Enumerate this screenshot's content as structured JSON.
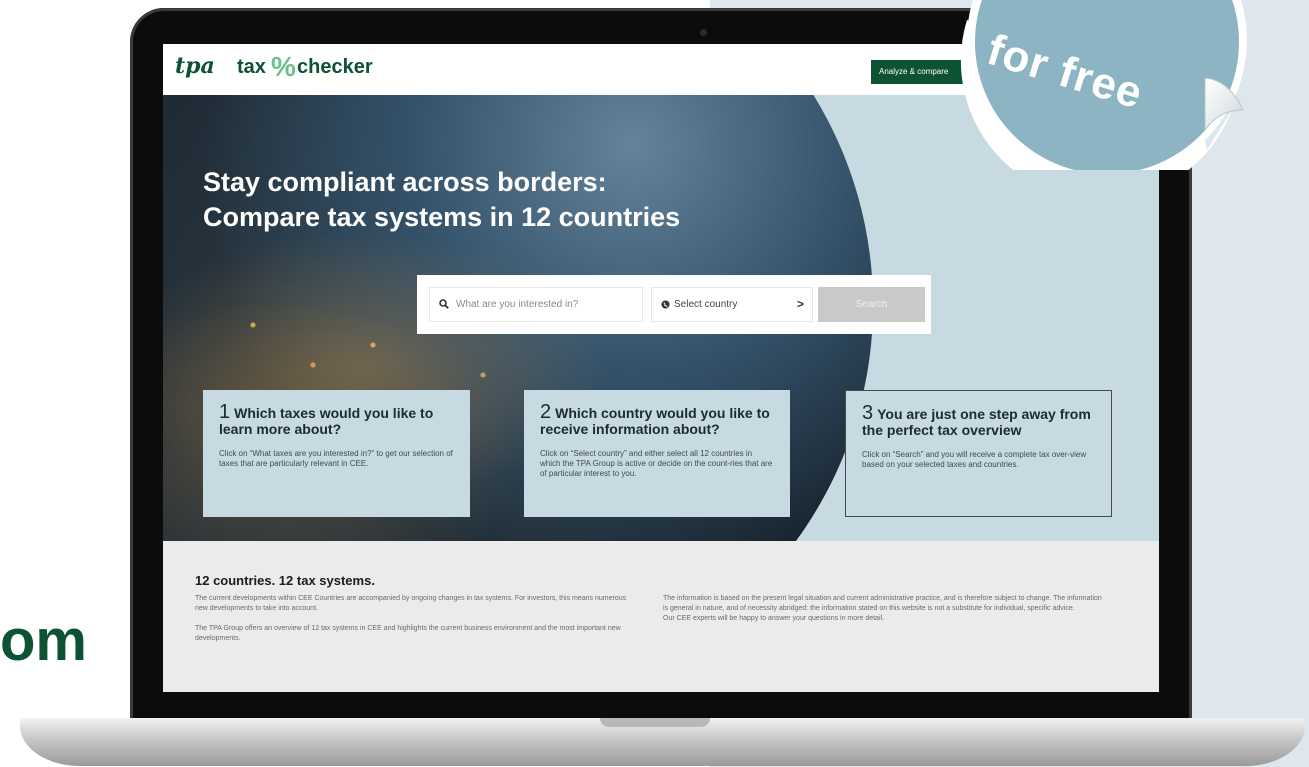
{
  "side_text": "om",
  "sticker": {
    "text": "for free"
  },
  "app": {
    "logo": {
      "tpa": "tpa",
      "tax": "tax",
      "percent": "%",
      "checker": "checker"
    },
    "header": {
      "analyze_button": "Analyze & compare"
    }
  },
  "hero": {
    "title_line1": "Stay compliant across borders:",
    "title_line2": "Compare tax systems in 12 countries",
    "search": {
      "placeholder": "What are you interested in?",
      "country_label": "Select country",
      "chevron": ">",
      "button_label": "Search"
    },
    "steps": [
      {
        "number": "1",
        "title": "Which taxes would you like to learn more about?",
        "text": "Click on “What taxes are you interested in?” to get our selection of taxes that are particularly relevant in CEE."
      },
      {
        "number": "2",
        "title": "Which country would you like to receive information about?",
        "text": "Click on “Select country” and either select all 12 countries in which the TPA Group is active or decide on the count-ries that are of particular interest to you."
      },
      {
        "number": "3",
        "title": "You are just one step away from the perfect tax overview",
        "text": "Click on “Search” and you will receive a complete tax over-view based on your selected taxes and countries."
      }
    ]
  },
  "info": {
    "heading": "12 countries. 12 tax systems.",
    "left_p1": "The current developments within CEE Countries are accompanied by ongoing changes in tax systems. For investors, this means numerous new developments to take into account.",
    "left_p2": "The TPA Group offers an overview of 12 tax systems in CEE and highlights the current business environment and the most important new developments.",
    "right_p1": "The information is based on the present legal situation and current administrative practice, and is therefore subject to change. The information is general in nature, and of necessity abridged: the information stated on this website is not a substitute for individual, specific advice.",
    "right_p2": "Our CEE experts will be happy to answer your questions in more detail."
  },
  "colors": {
    "brand_green": "#0d5233",
    "accent_green": "#6fbf8a",
    "card_blue": "#c7d9e1",
    "sticker_teal": "#8db4c2"
  }
}
